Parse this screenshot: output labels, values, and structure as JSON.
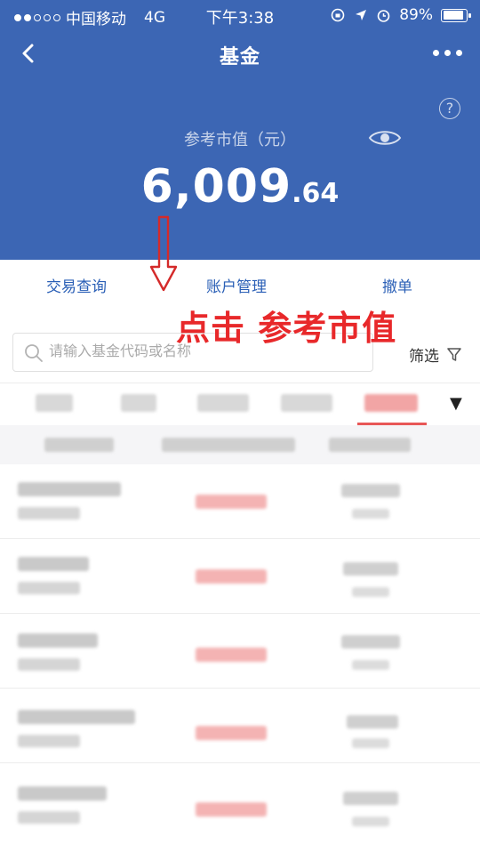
{
  "status_bar": {
    "carrier": "中国移动",
    "network": "4G",
    "time": "下午3:38",
    "battery": "89%",
    "battery_level": 0.89
  },
  "nav": {
    "title": "基金",
    "back_icon": "chevron-left-icon",
    "more_icon": "ellipsis-icon"
  },
  "summary": {
    "label": "参考市值（元）",
    "value_integer": "6,009",
    "value_decimal": ".64",
    "help_glyph": "?"
  },
  "actions": [
    {
      "label": "交易查询"
    },
    {
      "label": "账户管理"
    },
    {
      "label": "撤单"
    }
  ],
  "annotation": {
    "text": "点击 参考市值",
    "color": "#e8282a"
  },
  "search": {
    "placeholder": "请输入基金代码或名称",
    "filter_label": "筛选"
  },
  "colors": {
    "header_blue": "#3c66b4",
    "link_blue": "#2a5fb6",
    "accent_red": "#e85757"
  }
}
